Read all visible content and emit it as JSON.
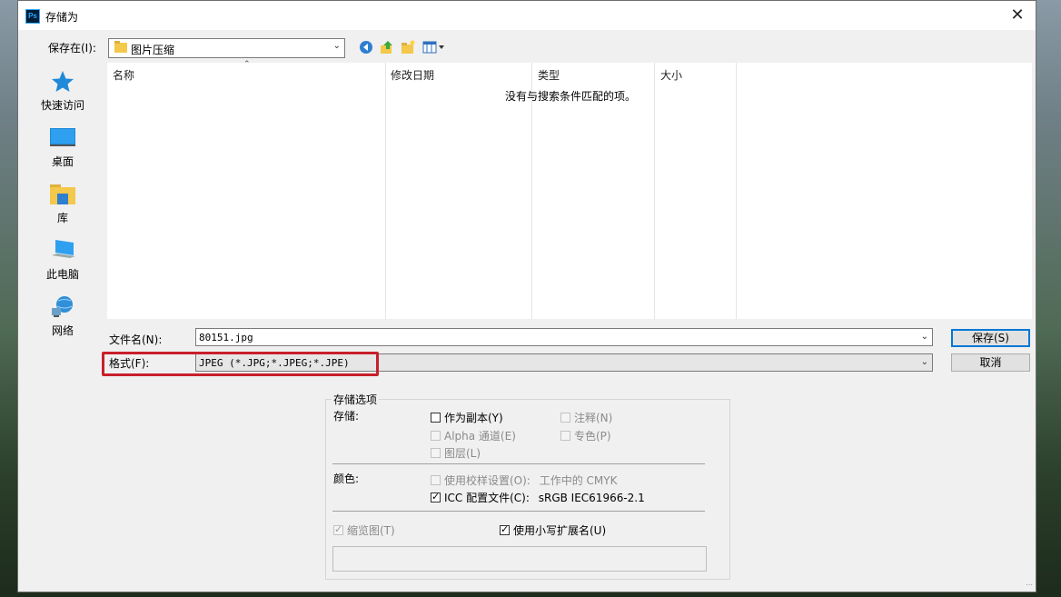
{
  "window": {
    "title": "存储为",
    "app_icon": "Ps",
    "close_glyph": "✕"
  },
  "savein": {
    "label": "保存在(I):",
    "folder": "图片压缩"
  },
  "toolbar": {
    "back_icon": "back-arrow-icon",
    "up_icon": "up-folder-icon",
    "new_folder_icon": "new-folder-icon",
    "view_icon": "view-menu-icon"
  },
  "sidebar": {
    "items": [
      {
        "label": "快速访问",
        "icon": "star-icon"
      },
      {
        "label": "桌面",
        "icon": "desktop-icon"
      },
      {
        "label": "库",
        "icon": "library-icon"
      },
      {
        "label": "此电脑",
        "icon": "computer-icon"
      },
      {
        "label": "网络",
        "icon": "network-icon"
      }
    ]
  },
  "filelist": {
    "columns": [
      "名称",
      "修改日期",
      "类型",
      "大小"
    ],
    "empty_message": "没有与搜索条件匹配的项。"
  },
  "filename": {
    "label": "文件名(N):",
    "value": "80151.jpg"
  },
  "format": {
    "label": "格式(F):",
    "value": "JPEG (*.JPG;*.JPEG;*.JPE)"
  },
  "buttons": {
    "save": "保存(S)",
    "cancel": "取消"
  },
  "options": {
    "group_title": "存储选项",
    "storage_label": "存储:",
    "as_copy": "作为副本(Y)",
    "alpha": "Alpha 通道(E)",
    "layers": "图层(L)",
    "notes": "注释(N)",
    "spot": "专色(P)",
    "color_label": "颜色:",
    "proof": "使用校样设置(O):",
    "proof_value": "工作中的 CMYK",
    "icc": "ICC 配置文件(C):",
    "icc_value": "sRGB IEC61966-2.1",
    "thumbnail": "缩览图(T)",
    "lowercase_ext": "使用小写扩展名(U)"
  },
  "colors": {
    "highlight": "#c8202b",
    "primary_border": "#0078d7"
  }
}
